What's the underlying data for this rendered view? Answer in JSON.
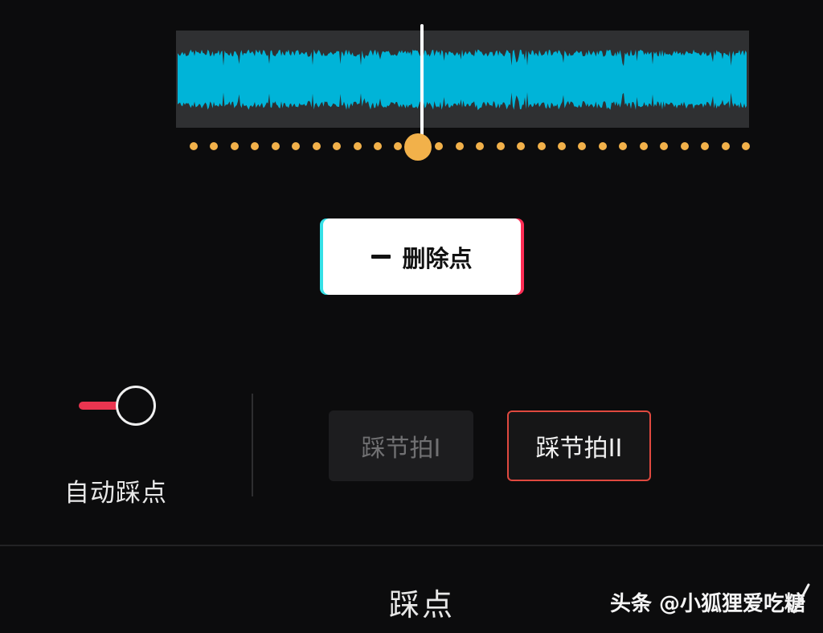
{
  "waveform": {
    "color": "#00b4d8",
    "track_color": "#2f3032"
  },
  "playhead": {
    "color": "#ffffff",
    "knob_color": "#f2b14a"
  },
  "beat_points": {
    "color": "#f2b14a",
    "count": 28
  },
  "delete_point": {
    "icon": "minus-icon",
    "label": "删除点"
  },
  "auto_beat": {
    "label": "自动踩点",
    "enabled": true,
    "accent": "#ea3550"
  },
  "beat_options": [
    {
      "label": "踩节拍I",
      "selected": false
    },
    {
      "label": "踩节拍II",
      "selected": true,
      "accent": "#e0493f"
    }
  ],
  "panel": {
    "title": "踩点",
    "confirm_icon": "check-icon"
  },
  "watermark": {
    "text": "头条 @小狐狸爱吃糖"
  }
}
